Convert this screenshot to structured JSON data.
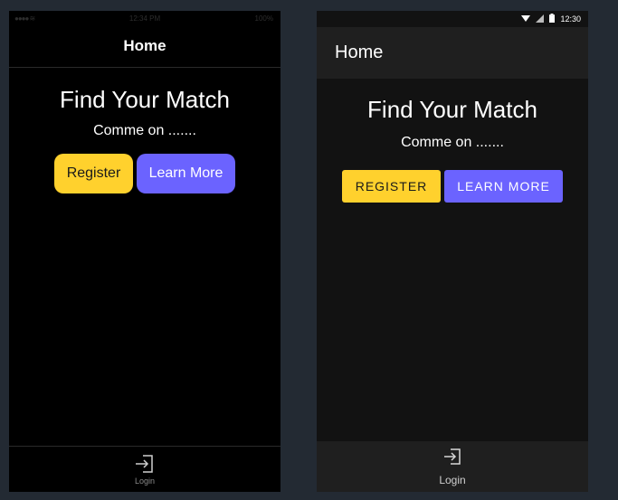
{
  "ios": {
    "status": {
      "carrier": "●●●● ≋",
      "time": "12:34 PM",
      "battery": "100%"
    },
    "header_title": "Home",
    "heading": "Find Your Match",
    "subtitle": "Comme on .......",
    "buttons": {
      "register": "Register",
      "learn_more": "Learn More"
    },
    "tab": {
      "icon": "login-icon",
      "label": "Login"
    }
  },
  "android": {
    "status": {
      "time": "12:30"
    },
    "appbar_title": "Home",
    "heading": "Find Your Match",
    "subtitle": "Comme on .......",
    "buttons": {
      "register": "Register",
      "learn_more": "Learn More"
    },
    "tab": {
      "icon": "login-icon",
      "label": "Login"
    }
  },
  "colors": {
    "background": "#232a33",
    "primary_button": "#ffd12d",
    "secondary_button": "#6b63ff",
    "ios_screen": "#000000",
    "android_screen": "#121212",
    "android_bar": "#1f1f1f"
  }
}
